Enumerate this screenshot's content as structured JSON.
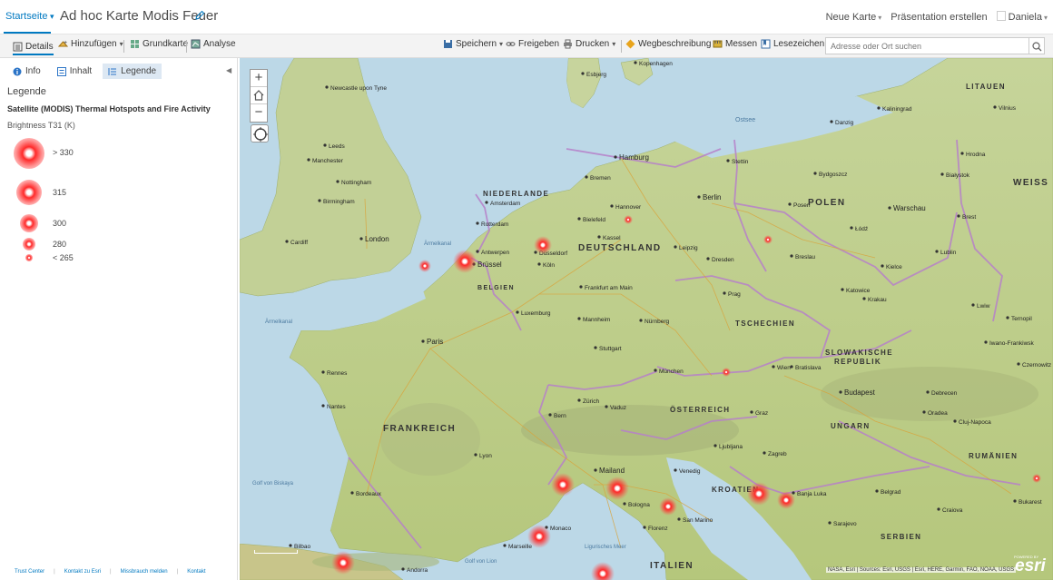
{
  "header": {
    "home_label": "Startseite",
    "map_title": "Ad hoc Karte Modis Feuer",
    "new_map": "Neue Karte",
    "create_presentation": "Präsentation erstellen",
    "user": "Daniela"
  },
  "toolbar": {
    "details": "Details",
    "add": "Hinzufügen",
    "basemap": "Grundkarte",
    "analysis": "Analyse",
    "save": "Speichern",
    "share": "Freigeben",
    "print": "Drucken",
    "directions": "Wegbeschreibung",
    "measure": "Messen",
    "bookmarks": "Lesezeichen",
    "search_placeholder": "Adresse oder Ort suchen"
  },
  "panel": {
    "tabs": [
      {
        "label": "Info",
        "icon": "info-icon"
      },
      {
        "label": "Inhalt",
        "icon": "content-icon"
      },
      {
        "label": "Legende",
        "icon": "legend-icon"
      }
    ],
    "legend_heading": "Legende",
    "layer_name": "Satellite (MODIS) Thermal Hotspots and Fire Activity",
    "field_name": "Brightness T31 (K)",
    "legend_items": [
      {
        "label": "> 330"
      },
      {
        "label": "315"
      },
      {
        "label": "300"
      },
      {
        "label": "280"
      },
      {
        "label": "< 265"
      }
    ],
    "footer_links": [
      "Trust Center",
      "Kontakt zu Esri",
      "Missbrauch melden",
      "Kontakt"
    ]
  },
  "map": {
    "countries": [
      "NIEDERLANDE",
      "DEUTSCHLAND",
      "POLEN",
      "BELGIEN",
      "TSCHECHIEN",
      "SLOWAKISCHE",
      "REPUBLIK",
      "FRANKREICH",
      "ÖSTERREICH",
      "UNGARN",
      "RUMÄNIEN",
      "KROATIEN",
      "SERBIEN",
      "ITALIEN",
      "LITAUEN",
      "WEISS"
    ],
    "cities": [
      "Newcastle upon Tyne",
      "Leeds",
      "Manchester",
      "Nottingham",
      "Birmingham",
      "Cardiff",
      "London",
      "Amsterdam",
      "Rotterdam",
      "Antwerpen",
      "Brüssel",
      "Köln",
      "Düsseldorf",
      "Hamburg",
      "Bremen",
      "Hannover",
      "Berlin",
      "Bielefeld",
      "Leipzig",
      "Dresden",
      "Stettin",
      "Danzig",
      "Kaliningrad",
      "Bydgoszcz",
      "Posen",
      "Warschau",
      "Łódź",
      "Lublin",
      "Breslau",
      "Kielce",
      "Krakau",
      "Katowice",
      "Prag",
      "Wien",
      "Bratislava",
      "Budapest",
      "Debrecen",
      "Cluj-Napoca",
      "Oradea",
      "Frankfurt am Main",
      "Luxemburg",
      "Paris",
      "Mannheim",
      "Stuttgart",
      "Nürnberg",
      "München",
      "Zürich",
      "Bern",
      "Vaduz",
      "Graz",
      "Ljubljana",
      "Zagreb",
      "Banja Luka",
      "Sarajevo",
      "Belgrad",
      "Craiova",
      "Bukarest",
      "Mailand",
      "Venedig",
      "Bologna",
      "Florenz",
      "San Marino",
      "Monaco",
      "Marseille",
      "Lyon",
      "Nantes",
      "Rennes",
      "Bordeaux",
      "Bilbao",
      "Andorra",
      "Kopenhagen",
      "Esbjerg",
      "Vilnius",
      "Hrodna",
      "Białystok",
      "Brest",
      "Lwiw",
      "Ternopil",
      "Iwano-Frankiwsk",
      "Czernowitz",
      "Kassel"
    ],
    "seas": [
      "Ostsee",
      "Ärmelkanal",
      "Golf von Biskaya",
      "Golf von Lion",
      "Ligurisches Meer"
    ],
    "attribution": "NASA, Esri | Sources: Esri, USGS | Esri, HERE, Garmin, FAO, NOAA, USGS",
    "powered_by": "POWERED BY",
    "esri": "esri",
    "fires": [
      {
        "place": "Belgien",
        "level": "> 330"
      },
      {
        "place": "Düsseldorf",
        "level": "315"
      },
      {
        "place": "Ärmelkanal",
        "level": "300"
      },
      {
        "place": "Hannover",
        "level": "280"
      },
      {
        "place": "Tschechien",
        "level": "280"
      },
      {
        "place": "Österreich",
        "level": "280"
      },
      {
        "place": "Mailand",
        "level": "> 330"
      },
      {
        "place": "Turin",
        "level": "> 330"
      },
      {
        "place": "Bologna",
        "level": "315"
      },
      {
        "place": "Kroatien",
        "level": "> 330"
      },
      {
        "place": "Banja Luka",
        "level": "315"
      },
      {
        "place": "Monaco",
        "level": "> 330"
      },
      {
        "place": "Bilbao",
        "level": "> 330"
      },
      {
        "place": "Rom",
        "level": "> 330"
      },
      {
        "place": "Rumänien",
        "level": "280"
      }
    ]
  }
}
